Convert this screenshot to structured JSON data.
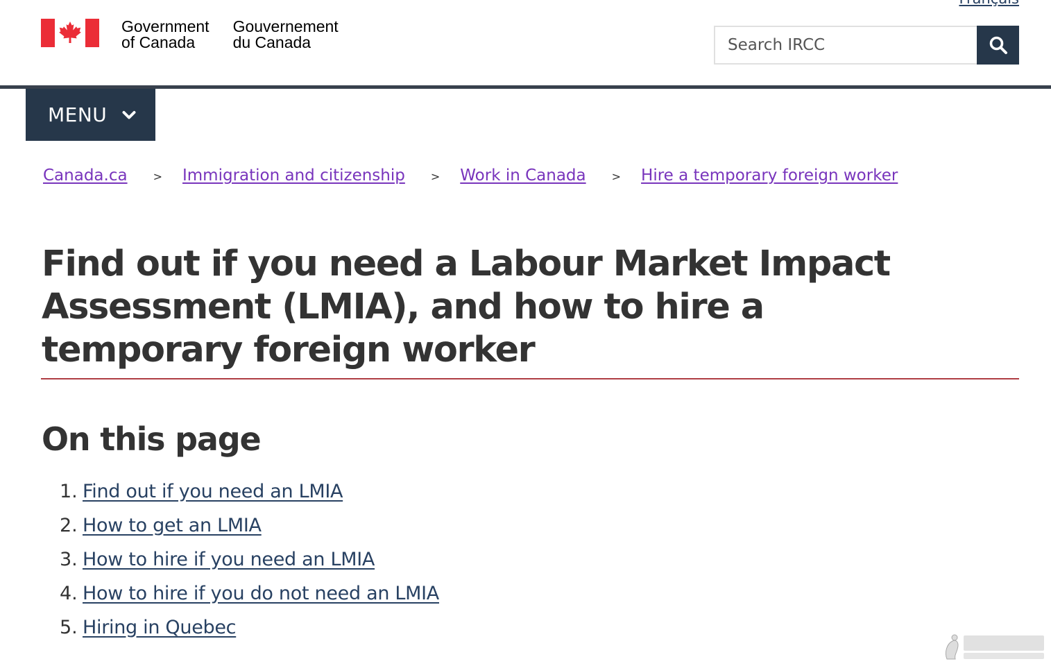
{
  "header": {
    "language_toggle": "Français",
    "signature_en_line1": "Government",
    "signature_en_line2": "of Canada",
    "signature_fr_line1": "Gouvernement",
    "signature_fr_line2": "du Canada",
    "search_placeholder": "Search IRCC",
    "search_icon": "magnifier-icon"
  },
  "nav": {
    "menu_label": "MENU",
    "menu_icon": "chevron-down-icon"
  },
  "breadcrumb": [
    "Canada.ca",
    "Immigration and citizenship",
    "Work in Canada",
    "Hire a temporary foreign worker"
  ],
  "breadcrumb_separator": ">",
  "page": {
    "title": "Find out if you need a Labour Market Impact Assessment (LMIA), and how to hire a temporary foreign worker",
    "on_this_page_heading": "On this page",
    "toc": [
      {
        "num": "1.",
        "label": "Find out if you need an LMIA"
      },
      {
        "num": "2.",
        "label": "How to get an LMIA"
      },
      {
        "num": "3.",
        "label": "How to hire if you need an LMIA"
      },
      {
        "num": "4.",
        "label": "How to hire if you do not need an LMIA"
      },
      {
        "num": "5.",
        "label": "Hiring in Quebec"
      }
    ]
  },
  "colors": {
    "brand_dark": "#26374a",
    "link": "#284162",
    "visited_link": "#7834bc",
    "title_rule": "#af3c43",
    "flag_red": "#eb2d37"
  }
}
